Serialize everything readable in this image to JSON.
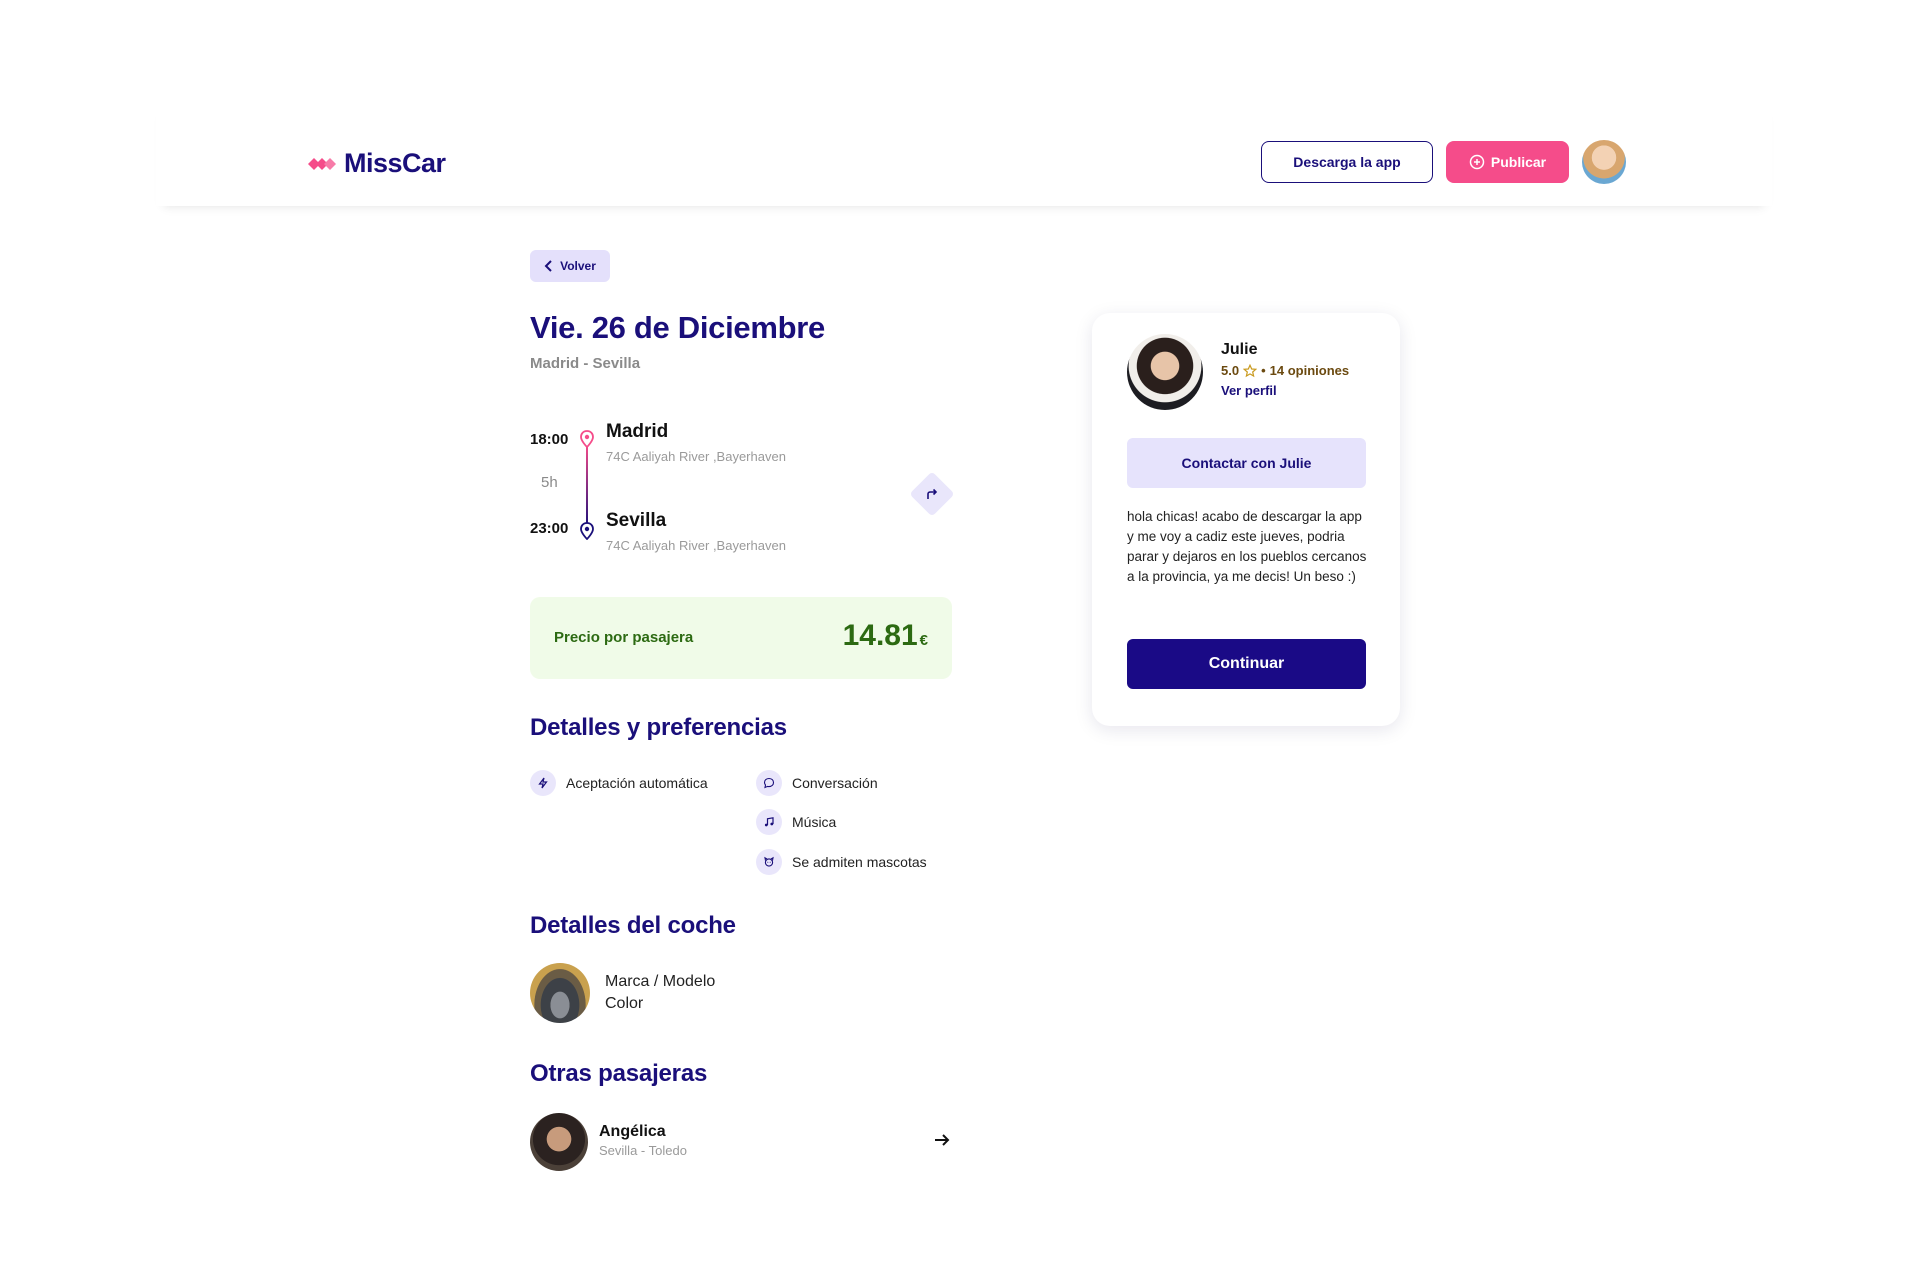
{
  "header": {
    "brand": "MissCar",
    "download_label": "Descarga la app",
    "publish_label": "Publicar"
  },
  "back_label": "Volver",
  "trip": {
    "date_title": "Vie. 26 de Diciembre",
    "route_summary": "Madrid - Sevilla",
    "departure": {
      "time": "18:00",
      "city": "Madrid",
      "address": "74C Aaliyah River ,Bayerhaven"
    },
    "duration": "5h",
    "arrival": {
      "time": "23:00",
      "city": "Sevilla",
      "address": "74C Aaliyah River ,Bayerhaven"
    }
  },
  "price": {
    "label": "Precio por pasajera",
    "value": "14.81",
    "currency": "€"
  },
  "preferences": {
    "title": "Detalles y preferencias",
    "items": [
      {
        "label": "Aceptación automática",
        "icon": "lightning-icon"
      },
      {
        "label": "Conversación",
        "icon": "chat-bubble-icon"
      },
      {
        "label": "Música",
        "icon": "music-note-icon"
      },
      {
        "label": "Se admiten mascotas",
        "icon": "pet-icon"
      }
    ]
  },
  "car": {
    "title": "Detalles del coche",
    "model": "Marca / Modelo",
    "color": "Color"
  },
  "passengers": {
    "title": "Otras pasajeras",
    "items": [
      {
        "name": "Angélica",
        "route": "Sevilla - Toledo"
      }
    ]
  },
  "driver": {
    "name": "Julie",
    "rating": "5.0",
    "separator": "•",
    "reviews": "14 opiniones",
    "profile_link": "Ver perfil",
    "contact_label": "Contactar con Julie",
    "message": "hola chicas! acabo de descargar la app y me voy a cadiz este jueves, podria parar y dejaros en los pueblos cercanos a la provincia, ya me decis! Un beso :)",
    "continue_label": "Continuar"
  },
  "colors": {
    "primary": "#1a0f7a",
    "accent": "#f54c8a",
    "price_bg": "#f0fbe8",
    "price_text": "#2c6a12",
    "soft_purple": "#e6e3fc"
  }
}
